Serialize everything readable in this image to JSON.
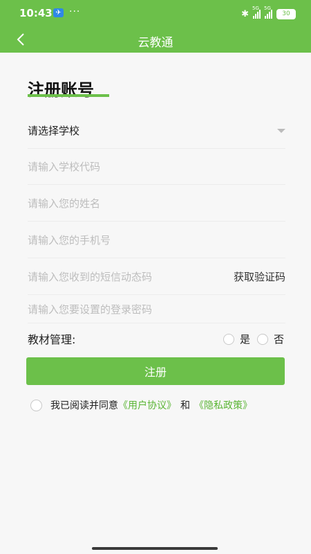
{
  "status_bar": {
    "time": "10:43",
    "more": "···",
    "network_5g_1": "5G",
    "network_5g_2": "5G",
    "battery": "30"
  },
  "nav": {
    "title": "云教通"
  },
  "page": {
    "heading": "注册账号"
  },
  "form": {
    "school_select": "请选择学校",
    "school_code_placeholder": "请输入学校代码",
    "name_placeholder": "请输入您的姓名",
    "phone_placeholder": "请输入您的手机号",
    "sms_code_placeholder": "请输入您收到的短信动态码",
    "get_code_label": "获取验证码",
    "password_placeholder": "请输入您要设置的登录密码",
    "material_label": "教材管理:",
    "option_yes": "是",
    "option_no": "否",
    "register_label": "注册"
  },
  "agreement": {
    "prefix": "我已阅读并同意",
    "user_agreement": "《用户协议》",
    "and": "和",
    "privacy_policy": "《隐私政策》"
  },
  "colors": {
    "accent": "#6cc04a",
    "link": "#5ab534"
  },
  "icons": {
    "back": "chevron-left-icon",
    "dropdown": "triangle-down-icon",
    "bluetooth": "bluetooth-icon"
  }
}
